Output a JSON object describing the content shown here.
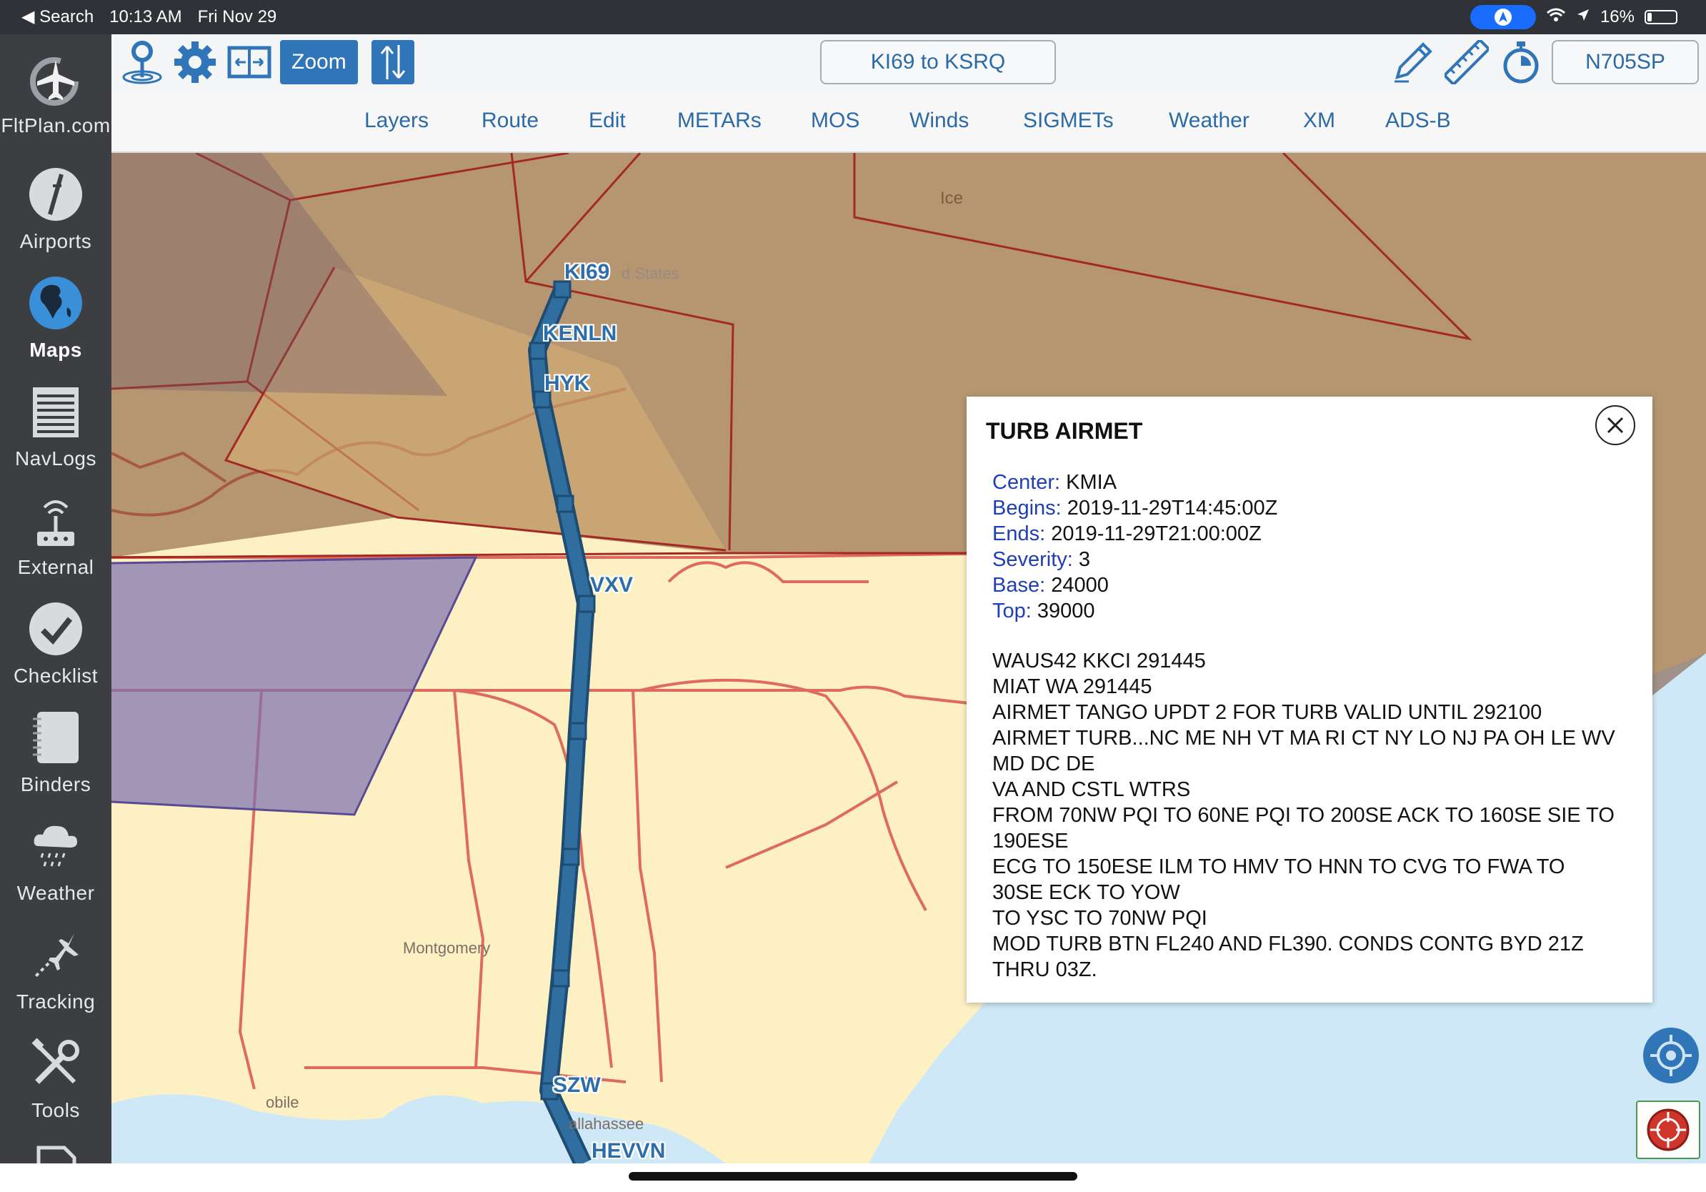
{
  "status_bar": {
    "back_label": "◀ Search",
    "time": "10:13 AM",
    "date": "Fri Nov 29",
    "battery": "16%"
  },
  "sidebar": {
    "items": [
      {
        "label": "FltPlan.com",
        "icon": "fltplan-logo-icon"
      },
      {
        "label": "Airports",
        "icon": "airport-runway-icon"
      },
      {
        "label": "Maps",
        "icon": "globe-icon"
      },
      {
        "label": "NavLogs",
        "icon": "navlog-document-icon"
      },
      {
        "label": "External",
        "icon": "antenna-icon"
      },
      {
        "label": "Checklist",
        "icon": "checkmark-icon"
      },
      {
        "label": "Binders",
        "icon": "binder-icon"
      },
      {
        "label": "Weather",
        "icon": "rain-cloud-icon"
      },
      {
        "label": "Tracking",
        "icon": "airplane-track-icon"
      },
      {
        "label": "Tools",
        "icon": "wrench-screwdriver-icon"
      }
    ]
  },
  "toolbar": {
    "zoom_label": "Zoom",
    "route_label": "KI69 to KSRQ",
    "aircraft_label": "N705SP"
  },
  "menu": [
    "Layers",
    "Route",
    "Edit",
    "METARs",
    "MOS",
    "Winds",
    "SIGMETs",
    "Weather",
    "XM",
    "ADS-B"
  ],
  "map": {
    "labels": {
      "ice": "Ice",
      "united_states": "d States",
      "montgomery": "Montgomery",
      "mobile": "obile",
      "tallahassee": "allahassee"
    },
    "waypoints": [
      "KI69",
      "KENLN",
      "HYK",
      "VXV",
      "SZW",
      "HEVVN"
    ],
    "colors": {
      "route": "#2f6e9e",
      "airmet_fill": "#7a4a2e",
      "state_lines": "#d9534f",
      "land": "#fdf1c4",
      "water": "#cfe8f7"
    }
  },
  "popup": {
    "title": "TURB AIRMET",
    "fields": [
      {
        "key": "Center:",
        "value": " KMIA"
      },
      {
        "key": "Begins:",
        "value": " 2019-11-29T14:45:00Z"
      },
      {
        "key": "Ends:",
        "value": " 2019-11-29T21:00:00Z"
      },
      {
        "key": "Severity:",
        "value": " 3"
      },
      {
        "key": "Base:",
        "value": " 24000"
      },
      {
        "key": "Top:",
        "value": " 39000"
      }
    ],
    "body_lines": [
      "WAUS42 KKCI 291445",
      "MIAT WA 291445",
      "AIRMET TANGO UPDT 2 FOR TURB VALID UNTIL 292100",
      "AIRMET TURB...NC ME NH VT MA RI CT NY LO NJ PA OH LE WV",
      "MD DC DE",
      "VA AND CSTL WTRS",
      "FROM 70NW PQI TO 60NE PQI TO 200SE ACK TO 160SE SIE TO",
      "190ESE",
      "ECG TO 150ESE ILM TO HMV TO HNN TO CVG TO FWA TO",
      "30SE ECK TO YOW",
      "TO YSC TO 70NW PQI",
      "MOD TURB BTN FL240 AND FL390. CONDS CONTG BYD 21Z",
      "THRU 03Z."
    ]
  }
}
